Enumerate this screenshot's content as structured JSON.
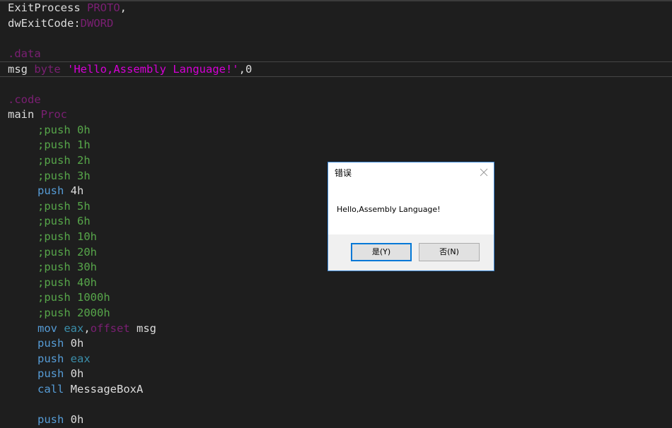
{
  "editor": {
    "lines": {
      "l1": {
        "name": "ExitProcess",
        "kw": "PROTO",
        "tail": ","
      },
      "l2": {
        "name": "dwExitCode:",
        "kw": "DWORD"
      },
      "l4": {
        "kw": ".data"
      },
      "l5": {
        "name": "msg",
        "kw": "byte",
        "str": "'Hello,Assembly Language!'",
        "tail": ",0"
      },
      "l7": {
        "kw": ".code"
      },
      "l8": {
        "name": "main",
        "kw": "Proc"
      },
      "l9": {
        "comment": ";push 0h"
      },
      "l10": {
        "comment": ";push 1h"
      },
      "l11": {
        "comment": ";push 2h"
      },
      "l12": {
        "comment": ";push 3h"
      },
      "l13": {
        "instr": "push",
        "operand": " 4h"
      },
      "l14": {
        "comment": ";push 5h"
      },
      "l15": {
        "comment": ";push 6h"
      },
      "l16": {
        "comment": ";push 10h"
      },
      "l17": {
        "comment": ";push 20h"
      },
      "l18": {
        "comment": ";push 30h"
      },
      "l19": {
        "comment": ";push 40h"
      },
      "l20": {
        "comment": ";push 1000h"
      },
      "l21": {
        "comment": ";push 2000h"
      },
      "l22": {
        "instr": "mov",
        "reg": "eax",
        "comma": ",",
        "kw": "offset",
        "operand": " msg"
      },
      "l23": {
        "instr": "push",
        "operand": " 0h"
      },
      "l24": {
        "instr": "push",
        "reg": "eax"
      },
      "l25": {
        "instr": "push",
        "operand": " 0h"
      },
      "l26": {
        "instr": "call",
        "operand": " MessageBoxA"
      },
      "l28": {
        "instr": "push",
        "operand": " 0h"
      }
    }
  },
  "dialog": {
    "title": "错误",
    "message": "Hello,Assembly Language!",
    "yes_label": "是(Y)",
    "no_label": "否(N)",
    "close_icon": "close-icon"
  },
  "colors": {
    "background": "#1e1e1e",
    "plain": "#dcdcdc",
    "keyword": "#7b1f73",
    "string": "#d500d5",
    "comment": "#57a64a",
    "instruction": "#569cd6",
    "register": "#3b8eaa",
    "dialog_border": "#3a86d4",
    "button_focus": "#0078d7"
  }
}
